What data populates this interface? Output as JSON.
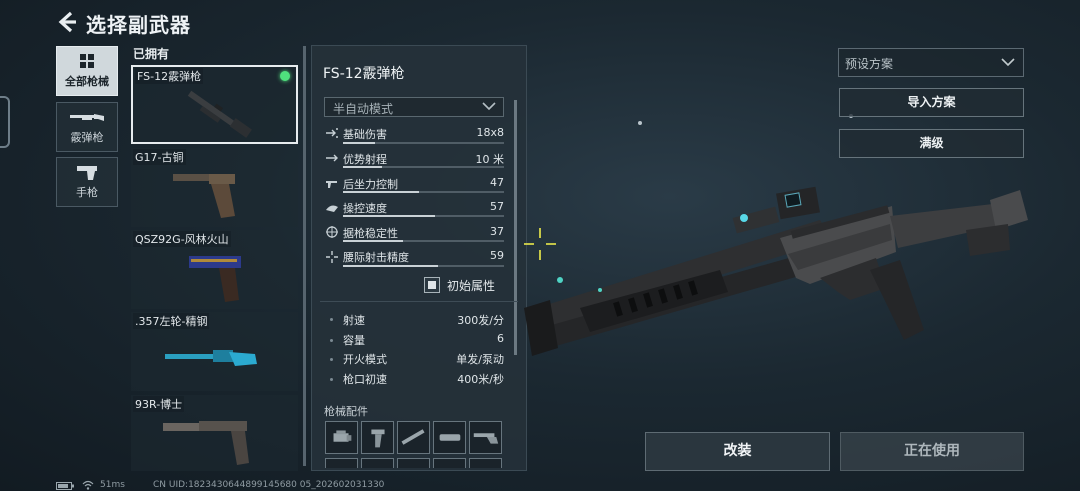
{
  "header": {
    "title": "选择副武器"
  },
  "categories": [
    {
      "label": "全部枪械",
      "icon": "grid-icon",
      "active": true
    },
    {
      "label": "霰弹枪",
      "icon": "shotgun-icon",
      "active": false
    },
    {
      "label": "手枪",
      "icon": "pistol-icon",
      "active": false
    }
  ],
  "list": {
    "section_label": "已拥有",
    "weapons": [
      {
        "name": "FS-12霰弹枪",
        "selected": true,
        "equipped": true
      },
      {
        "name": "G17-古铜"
      },
      {
        "name": "QSZ92G-风林火山"
      },
      {
        "name": ".357左轮-精钢"
      },
      {
        "name": "93R-博士"
      }
    ]
  },
  "detail": {
    "name": "FS-12霰弹枪",
    "fire_mode_select": "半自动模式",
    "stats": [
      {
        "label": "基础伤害",
        "value": "18x8",
        "fill": 0.2,
        "icon": "damage-icon"
      },
      {
        "label": "优势射程",
        "value": "10 米",
        "fill": 0.24,
        "icon": "range-icon"
      },
      {
        "label": "后坐力控制",
        "value": "47",
        "fill": 0.47,
        "icon": "recoil-icon"
      },
      {
        "label": "操控速度",
        "value": "57",
        "fill": 0.57,
        "icon": "handling-icon"
      },
      {
        "label": "据枪稳定性",
        "value": "37",
        "fill": 0.37,
        "icon": "stability-icon"
      },
      {
        "label": "腰际射击精度",
        "value": "59",
        "fill": 0.59,
        "icon": "hipfire-icon"
      }
    ],
    "base_attr_label": "初始属性",
    "specs": [
      {
        "label": "射速",
        "value": "300发/分"
      },
      {
        "label": "容量",
        "value": "6"
      },
      {
        "label": "开火模式",
        "value": "单发/泵动"
      },
      {
        "label": "枪口初速",
        "value": "400米/秒"
      }
    ],
    "attachments_title": "枪械配件",
    "attachments": [
      "sight-attachment-icon",
      "grip-attachment-icon",
      "muzzle-attachment-icon",
      "barrel-attachment-icon",
      "stock-attachment-icon"
    ]
  },
  "right": {
    "preset_placeholder": "预设方案",
    "import_label": "导入方案",
    "max_label": "满级",
    "modify_label": "改装",
    "in_use_label": "正在使用"
  },
  "footer": {
    "ping": "51ms",
    "uid": "CN UID:1823430644899145680 05_202602031330"
  },
  "colors": {
    "equipped_dot": "#4fe07d",
    "crosshair": "#d8d94a"
  }
}
